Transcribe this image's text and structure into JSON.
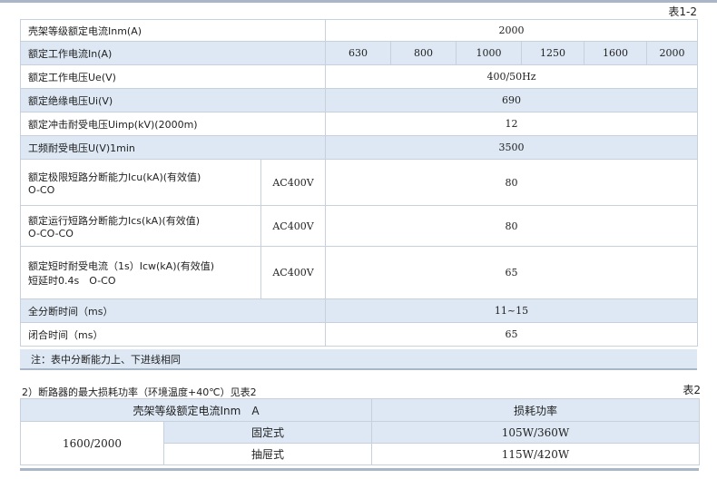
{
  "table1": {
    "caption": "表1-2",
    "rows": {
      "frame_current": {
        "label": "壳架等级额定电流Inm(A)",
        "value": "2000"
      },
      "rated_current": {
        "label": "额定工作电流In(A)",
        "values": [
          "630",
          "800",
          "1000",
          "1250",
          "1600",
          "2000"
        ]
      },
      "rated_voltage": {
        "label": "额定工作电压Ue(V)",
        "value": "400/50Hz"
      },
      "insulation_voltage": {
        "label": "额定绝缘电压Ui(V)",
        "value": "690"
      },
      "impulse_voltage": {
        "label": "额定冲击耐受电压Uimp(kV)(2000m)",
        "value": "12"
      },
      "power_freq_voltage": {
        "label": "工频耐受电压U(V)1min",
        "value": "3500"
      },
      "icu": {
        "label_line1": "额定极限短路分断能力Icu(kA)(有效值)",
        "label_line2": "O-CO",
        "condition": "AC400V",
        "value": "80"
      },
      "ics": {
        "label_line1": "额定运行短路分断能力Ics(kA)(有效值)",
        "label_line2": "O-CO-CO",
        "condition": "AC400V",
        "value": "80"
      },
      "icw": {
        "label_line1": "额定短时耐受电流（1s）Icw(kA)(有效值)",
        "label_line2": "短延时0.4s　O-CO",
        "condition": "AC400V",
        "value": "65"
      },
      "break_time": {
        "label": "全分断时间（ms）",
        "value": "11~15"
      },
      "close_time": {
        "label": "闭合时间（ms）",
        "value": "65"
      }
    },
    "note": "注：表中分断能力上、下进线相同"
  },
  "section2": {
    "heading": "2）断路器的最大损耗功率（环境温度+40℃）见表2",
    "caption": "表2"
  },
  "table2": {
    "header_left": "壳架等级额定电流Inm　A",
    "header_right": "损耗功率",
    "frame_value": "1600/2000",
    "rows": [
      {
        "type": "固定式",
        "value": "105W/360W"
      },
      {
        "type": "抽屉式",
        "value": "115W/420W"
      }
    ]
  },
  "colors": {
    "band": "#dde8f4",
    "rule": "#a9b6c8",
    "border": "#c7d1de"
  }
}
